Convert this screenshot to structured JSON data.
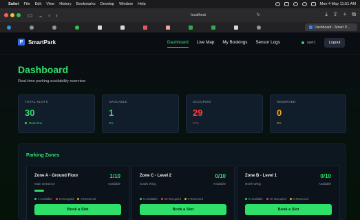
{
  "menubar": {
    "items": [
      "Safari",
      "File",
      "Edit",
      "View",
      "History",
      "Bookmarks",
      "Develop",
      "Window",
      "Help"
    ],
    "datetime": "Mon 4 May 11:51 AM"
  },
  "browser": {
    "address": "localhost",
    "active_tab_title": "Dashboard - Smart P..."
  },
  "colors": {
    "accent": "#2ee06a",
    "occupied": "#ff3b3b",
    "reserved": "#f5a623",
    "logo": "#2b6cf0"
  },
  "app": {
    "brand": "SmartPark",
    "nav": [
      "Dashboard",
      "Live Map",
      "My Bookings",
      "Sensor Logs"
    ],
    "user_label": "user1",
    "logout_label": "Logout",
    "title": "Dashboard",
    "subtitle": "Real-time parking availability overview",
    "stats": [
      {
        "label": "TOTAL SLOTS",
        "value": "30",
        "note": "Real-time"
      },
      {
        "label": "AVAILABLE",
        "value": "1",
        "note": "3%"
      },
      {
        "label": "OCCUPIED",
        "value": "29",
        "note": "97%"
      },
      {
        "label": "RESERVED",
        "value": "0",
        "note": "0%"
      }
    ],
    "zones_title": "Parking Zones",
    "zones": [
      {
        "name": "Zone A - Ground Floor",
        "location": "Main Entrance",
        "count": "1/10",
        "avail_label": "Available",
        "available": "1 Available",
        "occupied": "9 Occupied",
        "reserved": "0 Reserved",
        "button": "Book a Slot"
      },
      {
        "name": "Zone C - Level 2",
        "location": "South Wing",
        "count": "0/10",
        "avail_label": "Available",
        "available": "0 Available",
        "occupied": "10 Occupied",
        "reserved": "0 Reserved",
        "button": "Book a Slot"
      },
      {
        "name": "Zone B - Level 1",
        "location": "North Wing",
        "count": "0/10",
        "avail_label": "Available",
        "available": "0 Available",
        "occupied": "10 Occupied",
        "reserved": "0 Reserved",
        "button": "Book a Slot"
      }
    ]
  }
}
